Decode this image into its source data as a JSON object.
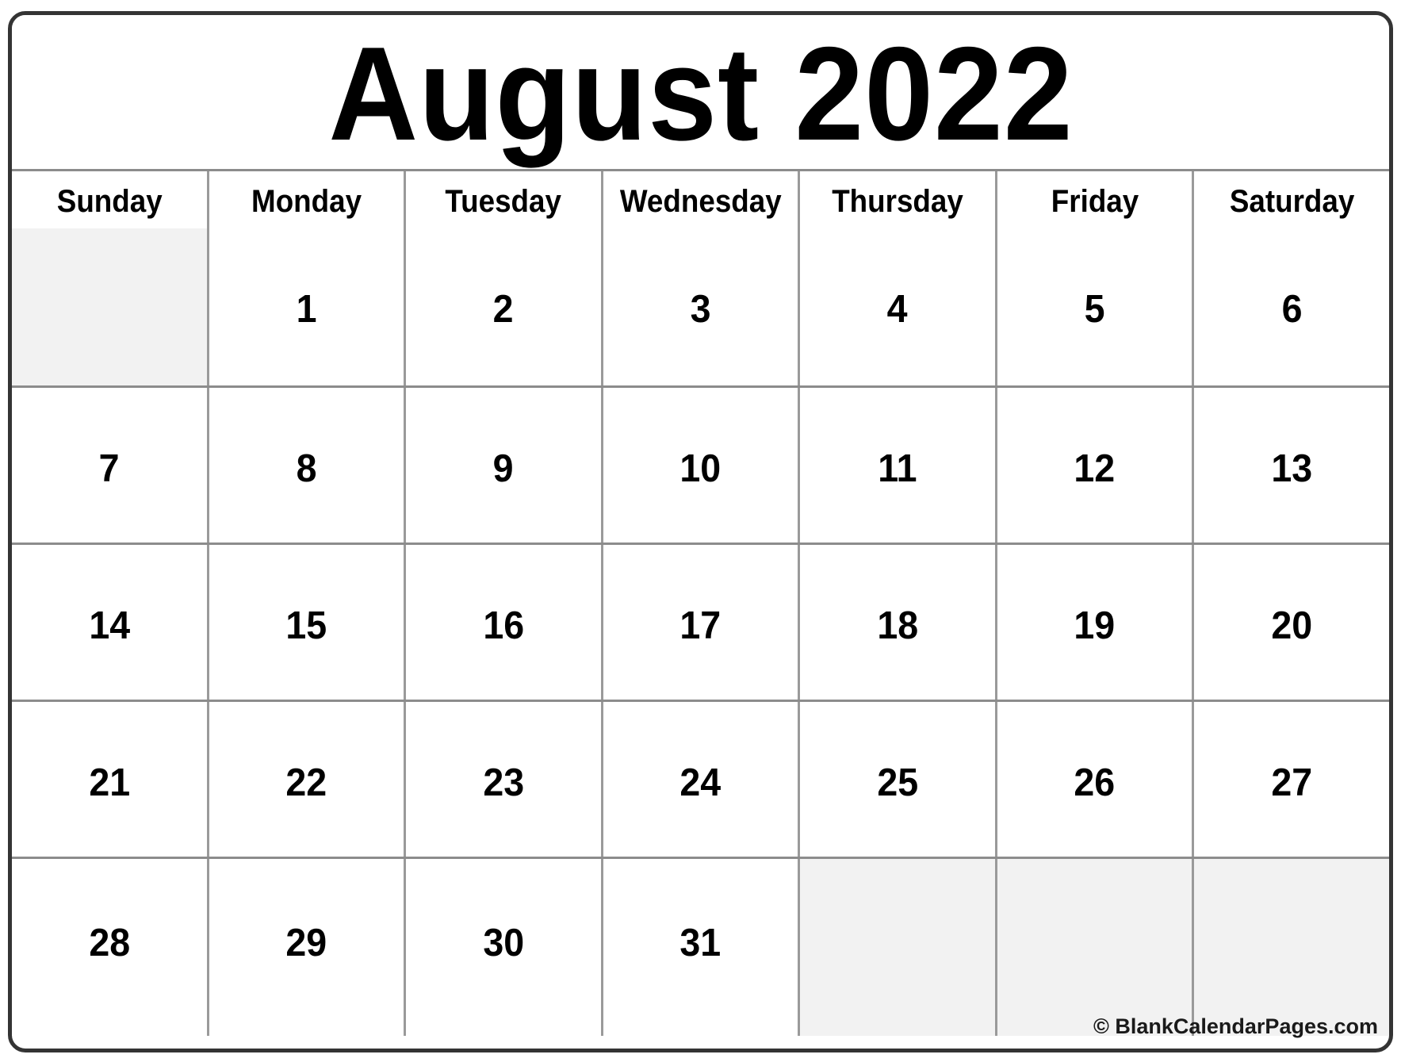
{
  "calendar": {
    "title": "August 2022",
    "month": "August",
    "year": "2022",
    "weekday_headers": [
      "Sunday",
      "Monday",
      "Tuesday",
      "Wednesday",
      "Thursday",
      "Friday",
      "Saturday"
    ],
    "weeks": [
      [
        "",
        "1",
        "2",
        "3",
        "4",
        "5",
        "6"
      ],
      [
        "7",
        "8",
        "9",
        "10",
        "11",
        "12",
        "13"
      ],
      [
        "14",
        "15",
        "16",
        "17",
        "18",
        "19",
        "20"
      ],
      [
        "21",
        "22",
        "23",
        "24",
        "25",
        "26",
        "27"
      ],
      [
        "28",
        "29",
        "30",
        "31",
        "",
        "",
        ""
      ]
    ],
    "footer_credit": "© BlankCalendarPages.com",
    "colors": {
      "frame_border": "#343434",
      "grid_line": "#9a9a9a",
      "blank_cell_background": "#f2f2f2",
      "cell_background": "#ffffff",
      "text": "#000000"
    }
  }
}
